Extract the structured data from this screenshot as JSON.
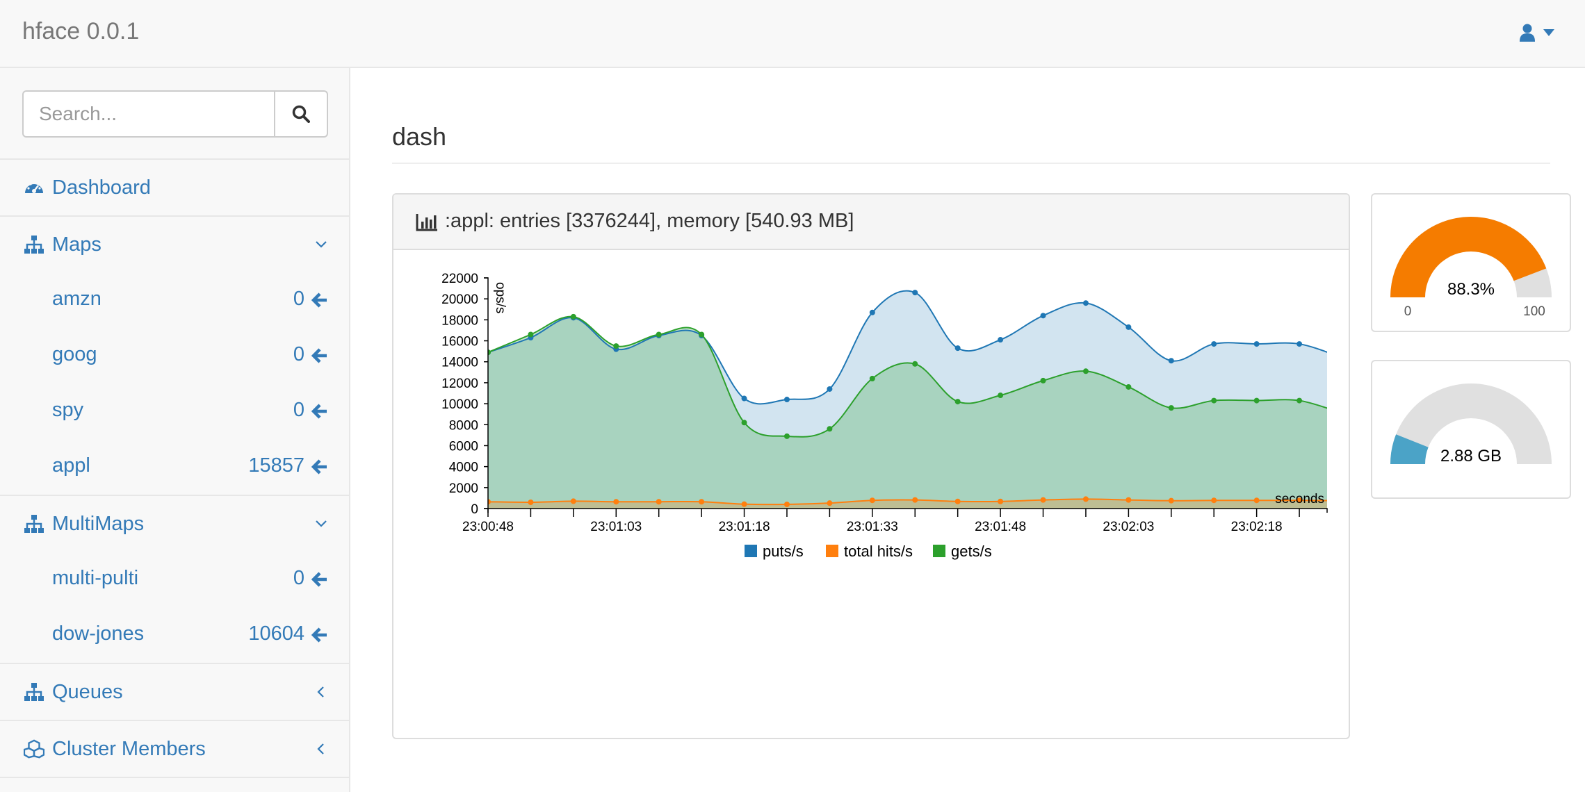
{
  "app": {
    "brand": "hface 0.0.1"
  },
  "header": {
    "user_icon": "user-icon",
    "caret_icon": "caret-down-icon"
  },
  "sidebar": {
    "search": {
      "placeholder": "Search...",
      "value": ""
    },
    "dashboard": {
      "label": "Dashboard",
      "icon": "dashboard-icon"
    },
    "maps": {
      "label": "Maps",
      "icon": "sitemap-icon",
      "expanded": true,
      "items": [
        {
          "label": "amzn",
          "count": "0"
        },
        {
          "label": "goog",
          "count": "0"
        },
        {
          "label": "spy",
          "count": "0"
        },
        {
          "label": "appl",
          "count": "15857"
        }
      ]
    },
    "multimaps": {
      "label": "MultiMaps",
      "icon": "sitemap-icon",
      "expanded": true,
      "items": [
        {
          "label": "multi-pulti",
          "count": "0"
        },
        {
          "label": "dow-jones",
          "count": "10604"
        }
      ]
    },
    "queues": {
      "label": "Queues",
      "icon": "sitemap-icon",
      "expanded": false
    },
    "cluster": {
      "label": "Cluster Members",
      "icon": "cubes-icon",
      "expanded": false
    }
  },
  "main": {
    "title": "dash",
    "panel": {
      "title": ":appl: entries [3376244], memory [540.93 MB]",
      "icon": "bar-chart-icon"
    }
  },
  "gauges": [
    {
      "value_text": "88.3%",
      "fraction": 0.883,
      "min_label": "0",
      "max_label": "100",
      "color": "#f57c00"
    },
    {
      "value_text": "2.88 GB",
      "fraction": 0.12,
      "color": "#4ba3c7"
    }
  ],
  "colors": {
    "link": "#337ab7",
    "puts": "#1f77b4",
    "hits": "#ff7f0e",
    "gets": "#2ca02c"
  },
  "chart_data": {
    "type": "area",
    "ylabel": "ops/s",
    "xlabel": "seconds",
    "ylim": [
      0,
      22000
    ],
    "yticks": [
      0,
      2000,
      4000,
      6000,
      8000,
      10000,
      12000,
      14000,
      16000,
      18000,
      20000,
      22000
    ],
    "x_start_label": "23:00:48",
    "x_step_seconds": 5,
    "x_tick_labels": [
      {
        "i": 0,
        "label": "23:00:48"
      },
      {
        "i": 3,
        "label": "23:01:03"
      },
      {
        "i": 6,
        "label": "23:01:18"
      },
      {
        "i": 9,
        "label": "23:01:33"
      },
      {
        "i": 12,
        "label": "23:01:48"
      },
      {
        "i": 15,
        "label": "23:02:03"
      },
      {
        "i": 18,
        "label": "23:02:18"
      }
    ],
    "x_end_index": 19.65,
    "series": [
      {
        "name": "puts/s",
        "color": "#1f77b4",
        "values": [
          14900,
          16300,
          18200,
          15200,
          16500,
          16500,
          10500,
          10400,
          11400,
          18700,
          20600,
          15300,
          16100,
          18400,
          19600,
          17300,
          14100,
          15700,
          15700,
          15700,
          14400
        ]
      },
      {
        "name": "total hits/s",
        "color": "#ff7f0e",
        "values": [
          650,
          600,
          700,
          650,
          650,
          650,
          420,
          400,
          520,
          780,
          820,
          680,
          680,
          820,
          900,
          820,
          750,
          780,
          780,
          780,
          750
        ]
      },
      {
        "name": "gets/s",
        "color": "#2ca02c",
        "values": [
          14900,
          16600,
          18300,
          15500,
          16600,
          16600,
          8200,
          6900,
          7600,
          12400,
          13800,
          10200,
          10800,
          12200,
          13100,
          11600,
          9600,
          10300,
          10300,
          10300,
          9100
        ]
      }
    ],
    "legend": {
      "placement": "bottom"
    }
  }
}
